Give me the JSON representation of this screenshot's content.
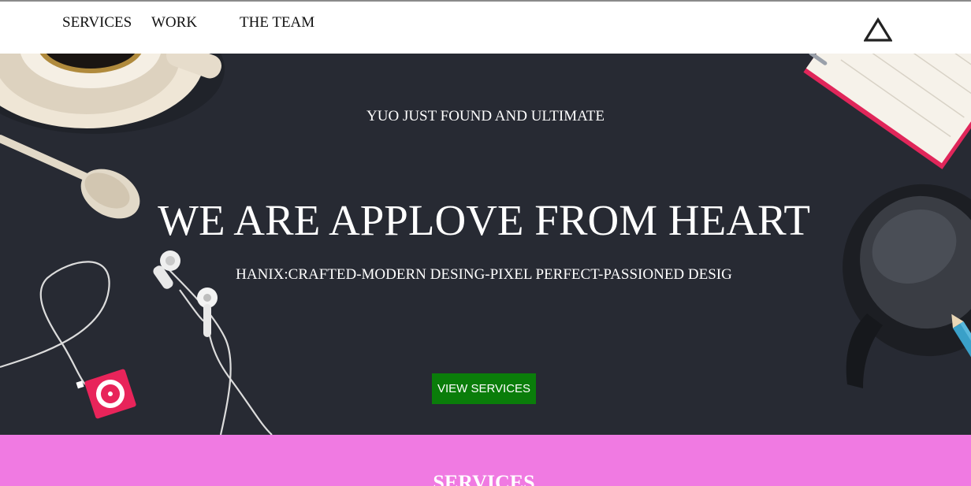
{
  "nav": {
    "items": [
      {
        "label": "SERVICES"
      },
      {
        "label": "WORK"
      },
      {
        "label": "THE TEAM"
      }
    ],
    "logo_icon": "triangle-logo-icon"
  },
  "hero": {
    "kicker": "YUO JUST FOUND AND ULTIMATE",
    "title": "WE ARE APPLOVE FROM HEART",
    "subtitle": "HANIX:CRAFTED-MODERN DESING-PIXEL PERFECT-PASSIONED DESIG",
    "button_label": "VIEW SERVICES",
    "background_color": "#272a33",
    "button_color": "#0a7d0a",
    "decorations": [
      "coffee-cup-icon",
      "spoon-icon",
      "earphones-icon",
      "music-player-icon",
      "notebook-icon",
      "glasses-icon",
      "pencil-icon"
    ]
  },
  "services": {
    "heading": "SERVICES",
    "background_color": "#f07ae2"
  }
}
